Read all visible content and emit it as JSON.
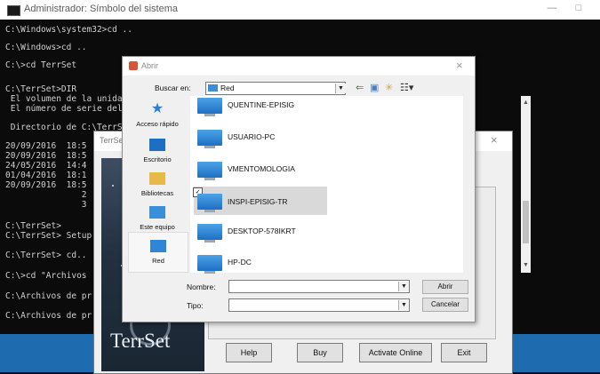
{
  "console": {
    "title": "Administrador: Símbolo del sistema",
    "min_glyph": "—",
    "max_glyph": "□",
    "lines": [
      "C:\\Windows\\system32>cd ..",
      "C:\\Windows>cd ..",
      "C:\\>cd TerrSet",
      "C:\\TerrSet>DIR",
      " El volumen de la unida",
      " El número de serie del",
      " Directorio de C:\\TerrS",
      "20/09/2016  18:5",
      "20/09/2016  18:5",
      "24/05/2016  14:4",
      "01/04/2016  18:1",
      "20/09/2016  18:5",
      "               2",
      "               3",
      "C:\\TerrSet>",
      "C:\\TerrSet> Setup",
      "C:\\TerrSet> cd..",
      "C:\\>cd \"Archivos",
      "C:\\Archivos de pr",
      "C:\\Archivos de pr"
    ]
  },
  "terrset": {
    "title": "TerrSet I",
    "close_glyph": "×",
    "logo": "TerrSet",
    "buttons": [
      "Help",
      "Buy",
      "Activate Online",
      "Exit"
    ]
  },
  "dialog": {
    "title": "Abrir",
    "close_glyph": "×",
    "look_in_label": "Buscar en:",
    "look_in_value": "Red",
    "places": [
      {
        "label": "Acceso rápido",
        "icon": "star-icon",
        "color": "#2a7fd4"
      },
      {
        "label": "Escritorio",
        "icon": "desktop-icon",
        "color": "#1e6fc4"
      },
      {
        "label": "Bibliotecas",
        "icon": "libraries-icon",
        "color": "#e8b84a"
      },
      {
        "label": "Este equipo",
        "icon": "computer-icon",
        "color": "#3a8fd8"
      },
      {
        "label": "Red",
        "icon": "network-icon",
        "color": "#2f86d6"
      }
    ],
    "files": [
      "QUENTINE-EPISIG",
      "USUARIO-PC",
      "VMENTOMOLOGIA",
      "INSPI-EPISIG-TR",
      "DESKTOP-578IKRT",
      "HP-DC"
    ],
    "name_label": "Nombre:",
    "type_label": "Tipo:",
    "open_button": "Abrir",
    "cancel_button": "Cancelar"
  }
}
